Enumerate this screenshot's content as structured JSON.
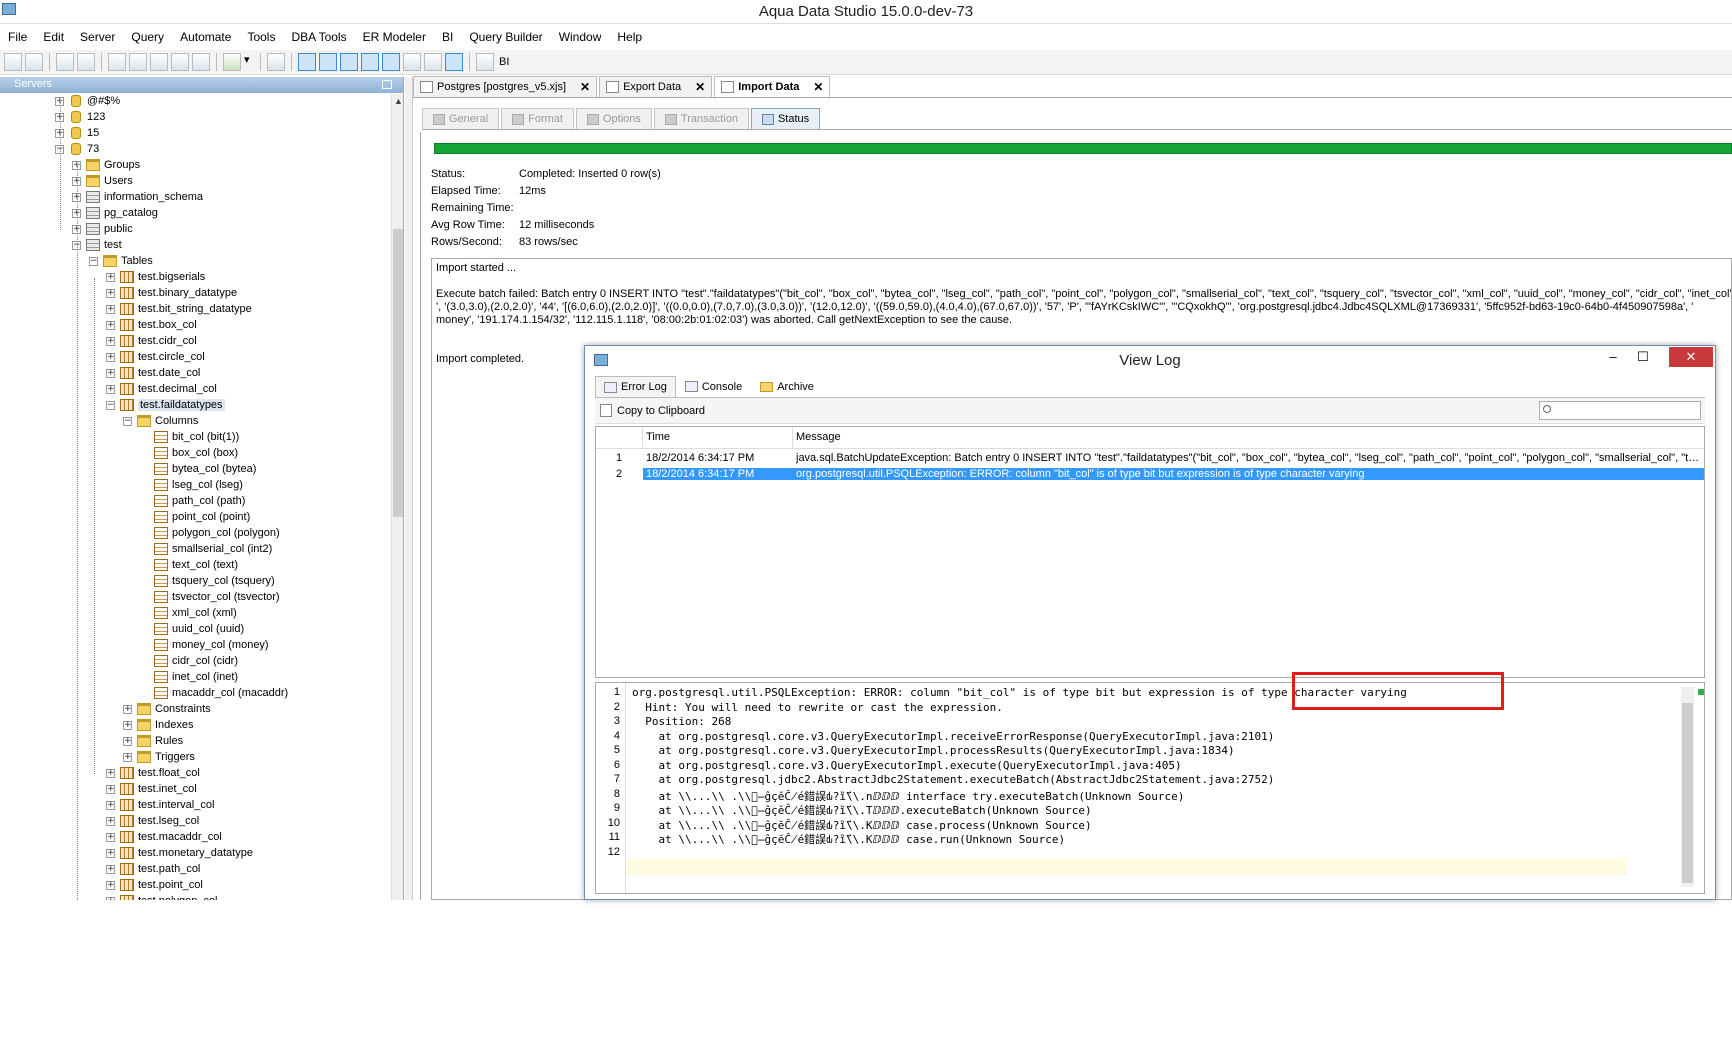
{
  "app": {
    "title": "Aqua Data Studio 15.0.0-dev-73"
  },
  "menu": [
    "File",
    "Edit",
    "Server",
    "Query",
    "Automate",
    "Tools",
    "DBA Tools",
    "ER Modeler",
    "BI",
    "Query Builder",
    "Window",
    "Help"
  ],
  "toolbar": {
    "bi_label": "BI"
  },
  "servers": {
    "title": "Servers",
    "tree": [
      {
        "label": "@#$%",
        "type": "db",
        "depth": 0
      },
      {
        "label": "123",
        "type": "db",
        "depth": 0
      },
      {
        "label": "15",
        "type": "db",
        "depth": 0
      },
      {
        "label": "73",
        "type": "db",
        "depth": 0,
        "expanded": true
      },
      {
        "label": "Groups",
        "type": "folder",
        "depth": 1
      },
      {
        "label": "Users",
        "type": "folder",
        "depth": 1
      },
      {
        "label": "information_schema",
        "type": "schema",
        "depth": 1
      },
      {
        "label": "pg_catalog",
        "type": "schema",
        "depth": 1
      },
      {
        "label": "public",
        "type": "schema",
        "depth": 1
      },
      {
        "label": "test",
        "type": "schema",
        "depth": 1,
        "expanded": true
      },
      {
        "label": "Tables",
        "type": "folder",
        "depth": 2,
        "expanded": true
      },
      {
        "label": "test.bigserials",
        "type": "table",
        "depth": 3
      },
      {
        "label": "test.binary_datatype",
        "type": "table",
        "depth": 3
      },
      {
        "label": "test.bit_string_datatype",
        "type": "table",
        "depth": 3
      },
      {
        "label": "test.box_col",
        "type": "table",
        "depth": 3
      },
      {
        "label": "test.cidr_col",
        "type": "table",
        "depth": 3
      },
      {
        "label": "test.circle_col",
        "type": "table",
        "depth": 3
      },
      {
        "label": "test.date_col",
        "type": "table",
        "depth": 3
      },
      {
        "label": "test.decimal_col",
        "type": "table",
        "depth": 3
      },
      {
        "label": "test.faildatatypes",
        "type": "table",
        "depth": 3,
        "expanded": true,
        "selected": true
      },
      {
        "label": "Columns",
        "type": "folder",
        "depth": 4,
        "expanded": true
      },
      {
        "label": "bit_col (bit(1))",
        "type": "column",
        "depth": 5
      },
      {
        "label": "box_col (box)",
        "type": "column",
        "depth": 5
      },
      {
        "label": "bytea_col (bytea)",
        "type": "column",
        "depth": 5
      },
      {
        "label": "lseg_col (lseg)",
        "type": "column",
        "depth": 5
      },
      {
        "label": "path_col (path)",
        "type": "column",
        "depth": 5
      },
      {
        "label": "point_col (point)",
        "type": "column",
        "depth": 5
      },
      {
        "label": "polygon_col (polygon)",
        "type": "column",
        "depth": 5
      },
      {
        "label": "smallserial_col (int2)",
        "type": "column",
        "depth": 5
      },
      {
        "label": "text_col (text)",
        "type": "column",
        "depth": 5
      },
      {
        "label": "tsquery_col (tsquery)",
        "type": "column",
        "depth": 5
      },
      {
        "label": "tsvector_col (tsvector)",
        "type": "column",
        "depth": 5
      },
      {
        "label": "xml_col (xml)",
        "type": "column",
        "depth": 5
      },
      {
        "label": "uuid_col (uuid)",
        "type": "column",
        "depth": 5
      },
      {
        "label": "money_col (money)",
        "type": "column",
        "depth": 5
      },
      {
        "label": "cidr_col (cidr)",
        "type": "column",
        "depth": 5
      },
      {
        "label": "inet_col (inet)",
        "type": "column",
        "depth": 5
      },
      {
        "label": "macaddr_col (macaddr)",
        "type": "column",
        "depth": 5
      },
      {
        "label": "Constraints",
        "type": "folder",
        "depth": 4
      },
      {
        "label": "Indexes",
        "type": "folder",
        "depth": 4
      },
      {
        "label": "Rules",
        "type": "folder",
        "depth": 4
      },
      {
        "label": "Triggers",
        "type": "folder",
        "depth": 4
      },
      {
        "label": "test.float_col",
        "type": "table",
        "depth": 3
      },
      {
        "label": "test.inet_col",
        "type": "table",
        "depth": 3
      },
      {
        "label": "test.interval_col",
        "type": "table",
        "depth": 3
      },
      {
        "label": "test.lseg_col",
        "type": "table",
        "depth": 3
      },
      {
        "label": "test.macaddr_col",
        "type": "table",
        "depth": 3
      },
      {
        "label": "test.monetary_datatype",
        "type": "table",
        "depth": 3
      },
      {
        "label": "test.path_col",
        "type": "table",
        "depth": 3
      },
      {
        "label": "test.point_col",
        "type": "table",
        "depth": 3
      },
      {
        "label": "test.polygon_col",
        "type": "table",
        "depth": 3
      }
    ]
  },
  "doc_tabs": [
    {
      "label": "Postgres [postgres_v5.xjs]",
      "active": false
    },
    {
      "label": "Export Data",
      "active": false
    },
    {
      "label": "Import Data",
      "active": true
    }
  ],
  "import_tabs": [
    {
      "label": "General",
      "active": false
    },
    {
      "label": "Format",
      "active": false
    },
    {
      "label": "Options",
      "active": false
    },
    {
      "label": "Transaction",
      "active": false
    },
    {
      "label": "Status",
      "active": true
    }
  ],
  "status": {
    "progress": 1.0,
    "fields": [
      {
        "key": "Status:",
        "value": "Completed: Inserted 0 row(s)"
      },
      {
        "key": "Elapsed Time:",
        "value": "12ms"
      },
      {
        "key": "Remaining Time:",
        "value": ""
      },
      {
        "key": "Avg Row Time:",
        "value": "12 milliseconds"
      },
      {
        "key": "Rows/Second:",
        "value": "83 rows/sec"
      }
    ],
    "log": [
      "Import started ...",
      "Execute batch failed: Batch entry 0 INSERT INTO \"test\".\"faildatatypes\"(\"bit_col\", \"box_col\", \"bytea_col\", \"lseg_col\", \"path_col\", \"point_col\", \"polygon_col\", \"smallserial_col\", \"text_col\", \"tsquery_col\", \"tsvector_col\", \"xml_col\", \"uuid_col\", \"money_col\", \"cidr_col\", \"inet_col\",",
      "', '(3.0,3.0),(2.0,2.0)', '44', '[(6.0,6.0),(2.0,2.0)]', '((0.0,0.0),(7.0,7.0),(3.0,3.0))', '(12.0,12.0)', '((59.0,59.0),(4.0,4.0),(67.0,67.0))', '57', 'P', '\"fAYrKCskIWC\"', '\"CQxokhQ\"', 'org.postgresql.jdbc4.Jdbc4SQLXML@17369331', '5ffc952f-bd63-19c0-64b0-4f450907598a', '",
      "money', '191.174.1.154/32', '112.115.1.118', '08:00:2b:01:02:03') was aborted.  Call getNextException to see the cause.",
      "Import completed."
    ]
  },
  "view_log": {
    "title": "View Log",
    "controls": {
      "minimize": "–",
      "maximize": "☐",
      "close": "✕"
    },
    "tabs": [
      {
        "label": "Error Log",
        "active": true
      },
      {
        "label": "Console",
        "active": false
      },
      {
        "label": "Archive",
        "active": false
      }
    ],
    "copy_label": "Copy to Clipboard",
    "search_placeholder": "",
    "columns": [
      "Time",
      "Message"
    ],
    "rows": [
      {
        "n": "1",
        "time": "18/2/2014 6:34:17 PM",
        "message": "java.sql.BatchUpdateException: Batch entry 0 INSERT INTO \"test\".\"faildatatypes\"(\"bit_col\", \"box_col\", \"bytea_col\", \"lseg_col\", \"path_col\", \"point_col\", \"polygon_col\", \"smallserial_col\", \"text...",
        "selected": false
      },
      {
        "n": "2",
        "time": "18/2/2014 6:34:17 PM",
        "message": "org.postgresql.util.PSQLException: ERROR: column \"bit_col\" is of type bit but expression is of type character varying",
        "selected": true
      }
    ],
    "detail_lines": [
      "org.postgresql.util.PSQLException: ERROR: column \"bit_col\" is of type bit but expression is of type character varying",
      "  Hint: You will need to rewrite or cast the expression.",
      "  Position: 268",
      "    at org.postgresql.core.v3.QueryExecutorImpl.receiveErrorResponse(QueryExecutorImpl.java:2101)",
      "    at org.postgresql.core.v3.QueryExecutorImpl.processResults(QueryExecutorImpl.java:1834)",
      "    at org.postgresql.core.v3.QueryExecutorImpl.execute(QueryExecutorImpl.java:405)",
      "    at org.postgresql.jdbc2.AbstractJdbc2Statement.executeBatch(AbstractJdbc2Statement.java:2752)",
      "    at \\\\...\\\\ .\\\\ⓡ̶ĝçĕĈ̸é錯誤ԃ?ȉ̈́\\\\.nⅅⅅⅅ interface try.executeBatch(Unknown Source)",
      "    at \\\\...\\\\ .\\\\ⓡ̶ĝçĕĈ̸é錯誤ԃ?ȉ̈́\\\\.Tⅅⅅⅅ.executeBatch(Unknown Source)",
      "    at \\\\...\\\\ .\\\\ⓡ̶ĝçĕĈ̸é錯誤ԃ?ȉ̈́\\\\.Kⅅⅅⅅ case.process(Unknown Source)",
      "    at \\\\...\\\\ .\\\\ⓡ̶ĝçĕĈ̸é錯誤ԃ?ȉ̈́\\\\.Kⅅⅅⅅ case.run(Unknown Source)",
      ""
    ]
  },
  "colors": {
    "progress": "#13a536",
    "highlight_box": "#e21b1b",
    "selection": "#3399ff"
  }
}
